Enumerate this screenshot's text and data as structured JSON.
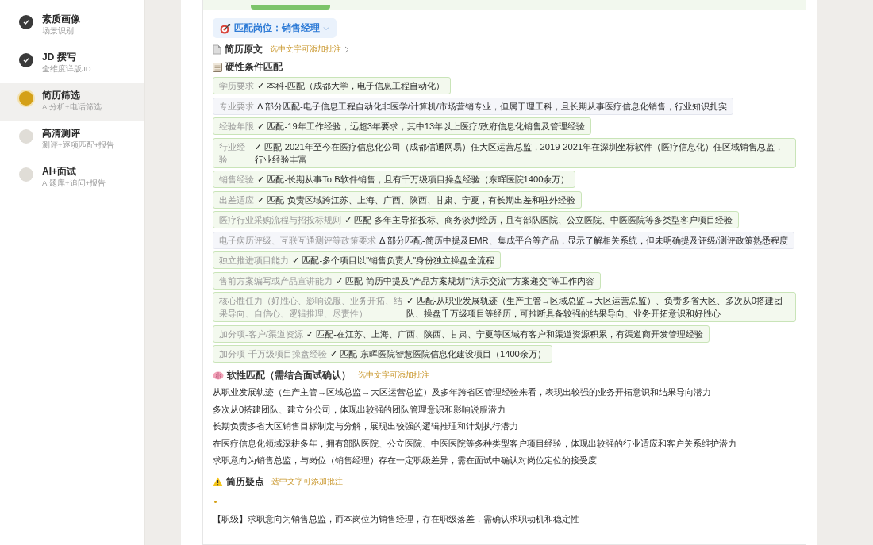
{
  "steps": [
    {
      "title": "素质画像",
      "subtitle": "场景识别",
      "kind": "done",
      "selected": false
    },
    {
      "title": "JD 撰写",
      "subtitle": "全维度详版JD",
      "kind": "done",
      "selected": false
    },
    {
      "title": "简历筛选",
      "subtitle": "AI分析+电话筛选",
      "kind": "active",
      "selected": true
    },
    {
      "title": "高清测评",
      "subtitle": "测评+逐项匹配+报告",
      "kind": "pending",
      "selected": false
    },
    {
      "title": "AI+面试",
      "subtitle": "AI题库+追问+报告",
      "kind": "pending",
      "selected": false
    }
  ],
  "position_selector": {
    "label": "匹配岗位：销售经理"
  },
  "resume_source": {
    "title": "简历原文",
    "hint": "选中文字可添加批注"
  },
  "hard_match": {
    "title": "硬性条件匹配",
    "rows": [
      {
        "label": "学历要求",
        "result": "✓ 本科-匹配（成都大学，电子信息工程自动化）",
        "kind": "match"
      },
      {
        "label": "专业要求",
        "result": "Δ 部分匹配-电子信息工程自动化非医学/计算机/市场营销专业，但属于理工科，且长期从事医疗信息化销售，行业知识扎实",
        "kind": "partial"
      },
      {
        "label": "经验年限",
        "result": "✓ 匹配-19年工作经验，远超3年要求，其中13年以上医疗/政府信息化销售及管理经验",
        "kind": "match"
      },
      {
        "label": "行业经验",
        "result": "✓ 匹配-2021年至今在医疗信息化公司（成都信通网易）任大区运营总监，2019-2021年在深圳坐标软件（医疗信息化）任区域销售总监，行业经验丰富",
        "kind": "match"
      },
      {
        "label": "销售经验",
        "result": "✓ 匹配-长期从事To B软件销售，且有千万级项目操盘经验（东晖医院1400余万）",
        "kind": "match"
      },
      {
        "label": "出差适应",
        "result": "✓ 匹配-负责区域跨江苏、上海、广西、陕西、甘肃、宁夏，有长期出差和驻外经验",
        "kind": "match"
      },
      {
        "label": "医疗行业采购流程与招投标规则",
        "result": "✓ 匹配-多年主导招投标、商务谈判经历，且有部队医院、公立医院、中医医院等多类型客户项目经验",
        "kind": "match"
      },
      {
        "label": "电子病历评级、互联互通测评等政策要求",
        "result": "Δ 部分匹配-简历中提及EMR、集成平台等产品，显示了解相关系统，但未明确提及评级/测评政策熟悉程度",
        "kind": "partial"
      },
      {
        "label": "独立推进项目能力",
        "result": "✓ 匹配-多个项目以\"销售负责人\"身份独立操盘全流程",
        "kind": "match"
      },
      {
        "label": "售前方案编写或产品宣讲能力",
        "result": "✓ 匹配-简历中提及\"产品方案规划\"\"演示交流\"\"方案递交\"等工作内容",
        "kind": "match"
      },
      {
        "label": "核心胜任力（好胜心、影响说服、业务开拓、结果导向、自信心、逻辑推理、尽责性）",
        "result": "✓ 匹配-从职业发展轨迹（生产主管→区域总监→大区运营总监）、负责多省大区、多次从0搭建团队、操盘千万级项目等经历，可推断具备较强的结果导向、业务开拓意识和好胜心",
        "kind": "match"
      },
      {
        "label": "加分项-客户/渠道资源",
        "result": "✓ 匹配-在江苏、上海、广西、陕西、甘肃、宁夏等区域有客户和渠道资源积累，有渠道商开发管理经验",
        "kind": "match"
      },
      {
        "label": "加分项-千万级项目操盘经验",
        "result": "✓ 匹配-东晖医院智慧医院信息化建设项目（1400余万）",
        "kind": "match"
      }
    ]
  },
  "soft_match": {
    "title": "软性匹配（需结合面试确认）",
    "hint": "选中文字可添加批注",
    "lines": [
      "从职业发展轨迹（生产主管→区域总监→大区运营总监）及多年跨省区管理经验来看，表现出较强的业务开拓意识和结果导向潜力",
      "多次从0搭建团队、建立分公司，体现出较强的团队管理意识和影响说服潜力",
      "长期负责多省大区销售目标制定与分解，展现出较强的逻辑推理和计划执行潜力",
      "在医疗信息化领域深耕多年，拥有部队医院、公立医院、中医医院等多种类型客户项目经验，体现出较强的行业适应和客户关系维护潜力",
      "求职意向为销售总监，与岗位（销售经理）存在一定职级差异，需在面试中确认对岗位定位的接受度"
    ]
  },
  "doubts": {
    "title": "简历疑点",
    "hint": "选中文字可添加批注",
    "items": [
      "【职级】求职意向为销售总监，而本岗位为销售经理，存在职级落差，需确认求职动机和稳定性"
    ]
  }
}
